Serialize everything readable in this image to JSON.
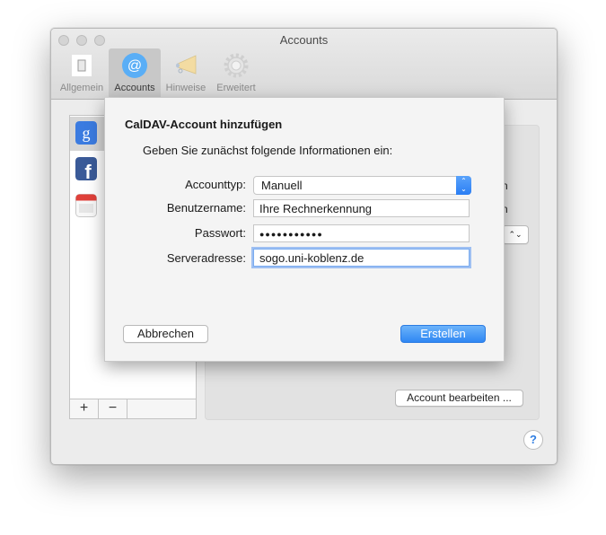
{
  "window": {
    "title": "Accounts",
    "toolbar": [
      {
        "label": "Allgemein",
        "icon": "switch-icon",
        "active": false
      },
      {
        "label": "Accounts",
        "icon": "at-sign-icon",
        "active": true
      },
      {
        "label": "Hinweise",
        "icon": "megaphone-icon",
        "active": false
      },
      {
        "label": "Erweitert",
        "icon": "gear-icon",
        "active": false
      }
    ]
  },
  "accounts_list": {
    "items": [
      {
        "icon": "google-icon",
        "selected": true
      },
      {
        "icon": "facebook-icon",
        "selected": false
      },
      {
        "icon": "calendar-icon",
        "selected": false
      }
    ],
    "add_label": "+",
    "remove_label": "−"
  },
  "detail": {
    "edit_account_button": "Account bearbeiten ...",
    "partial_text_1": "n",
    "partial_text_2": "n"
  },
  "help": {
    "label": "?"
  },
  "dialog": {
    "title": "CalDAV-Account hinzufügen",
    "subtitle": "Geben Sie zunächst folgende Informationen ein:",
    "fields": {
      "account_type": {
        "label": "Accounttyp:",
        "value": "Manuell"
      },
      "username": {
        "label": "Benutzername:",
        "value": "Ihre Rechnerkennung"
      },
      "password": {
        "label": "Passwort:",
        "value": "●●●●●●●●●●●"
      },
      "server": {
        "label": "Serveradresse:",
        "value": "sogo.uni-koblenz.de"
      }
    },
    "cancel_button": "Abbrechen",
    "create_button": "Erstellen"
  }
}
